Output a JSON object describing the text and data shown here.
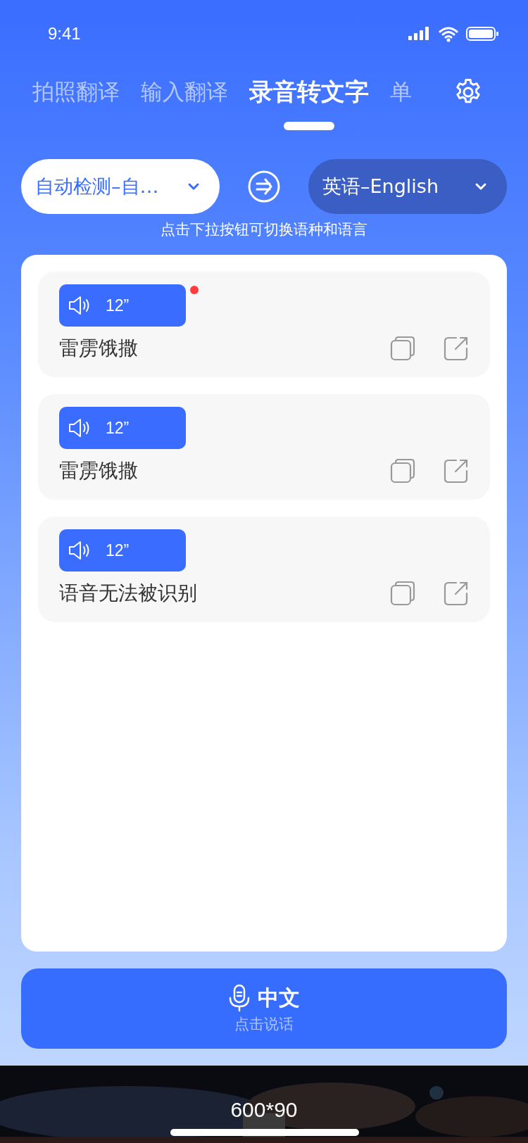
{
  "status_bar": {
    "time": "9:41"
  },
  "tabs": [
    {
      "label": "拍照翻译",
      "selected": false
    },
    {
      "label": "输入翻译",
      "selected": false
    },
    {
      "label": "录音转文字",
      "selected": true
    },
    {
      "label": "单",
      "selected": false
    }
  ],
  "languages": {
    "source": "自动检测–自…",
    "target": "英语–English",
    "hint": "点击下拉按钮可切换语种和语言"
  },
  "records": [
    {
      "duration": "12”",
      "unread": true,
      "text": "雷雳饿撒"
    },
    {
      "duration": "12”",
      "unread": false,
      "text": "雷雳饿撒"
    },
    {
      "duration": "12”",
      "unread": false,
      "text": "语音无法被识别"
    }
  ],
  "record_button": {
    "language": "中文",
    "hint": "点击说话"
  },
  "ad": {
    "kind": "picture",
    "size_label": "600*90"
  }
}
